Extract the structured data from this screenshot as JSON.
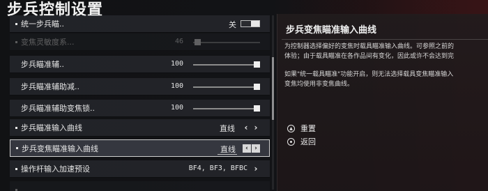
{
  "page": {
    "title": "步兵控制设置"
  },
  "settings": [
    {
      "label": "统一步兵瞄..",
      "value": "关",
      "control": "toggle",
      "style": "main",
      "state": "normal"
    },
    {
      "label": "变焦灵敏度系...",
      "value": "46",
      "control": "slider",
      "style": "main",
      "state": "dim"
    },
    {
      "label": "步兵瞄准辅..",
      "value": "100",
      "control": "slider",
      "style": "sub",
      "state": "normal"
    },
    {
      "label": "步兵瞄准辅助减..",
      "value": "100",
      "control": "slider",
      "style": "sub",
      "state": "normal"
    },
    {
      "label": "步兵瞄准辅助变焦锁..",
      "value": "100",
      "control": "slider",
      "style": "sub",
      "state": "normal"
    },
    {
      "label": "步兵瞄准输入曲线",
      "value": "直线",
      "control": "selector",
      "style": "main",
      "state": "normal"
    },
    {
      "label": "步兵变焦瞄准输入曲线",
      "value": "直线",
      "control": "selector",
      "style": "main",
      "state": "focused"
    },
    {
      "label": "操作杆输入加速预设",
      "value": "BF4, BF3, BFBC",
      "control": "selector",
      "style": "main",
      "state": "normal"
    }
  ],
  "description": {
    "title": "步兵变焦瞄准输入曲线",
    "lines": [
      "为控制器选择偏好的变焦时载具瞄准输入曲线。可参照之前的",
      "体验；由于载具瞄准在各作品间有变化，因此或许不会达到完",
      "",
      "如果\"统一载具瞄准\"功能开启，则无法选择载具变焦瞄准输入",
      "变焦均使用非变焦曲线。"
    ],
    "actions": [
      {
        "label": "重置",
        "icon": "triangle-button-icon"
      },
      {
        "label": "返回",
        "icon": "circle-button-icon"
      }
    ]
  },
  "colors": {
    "accent_red": "#2a1416",
    "focus_border": "#cfcfcf"
  }
}
